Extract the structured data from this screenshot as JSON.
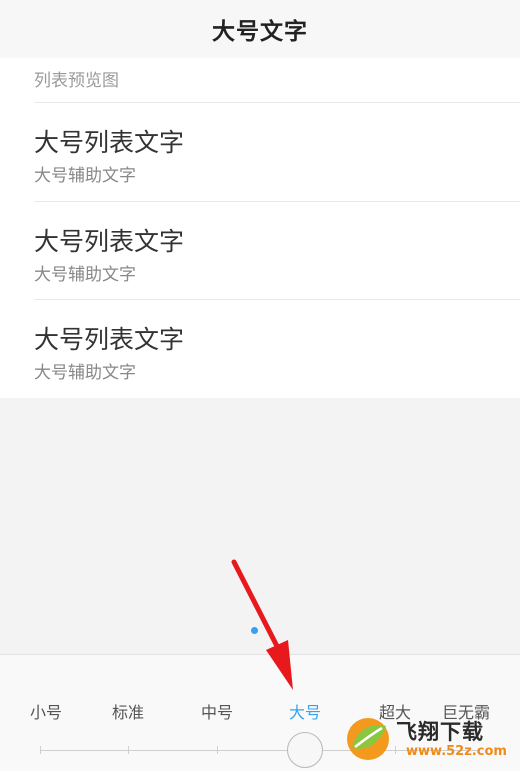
{
  "header": {
    "title": "大号文字"
  },
  "preview": {
    "label": "列表预览图",
    "items": [
      {
        "title": "大号列表文字",
        "subtitle": "大号辅助文字"
      },
      {
        "title": "大号列表文字",
        "subtitle": "大号辅助文字"
      },
      {
        "title": "大号列表文字",
        "subtitle": "大号辅助文字"
      }
    ]
  },
  "font_size_selector": {
    "options": [
      "小号",
      "标准",
      "中号",
      "大号",
      "超大",
      "巨无霸"
    ],
    "selected": "大号",
    "selected_index": 3,
    "accent_color": "#35a3ef"
  },
  "annotation": {
    "arrow_color": "#e8191c"
  },
  "watermark": {
    "name": "飞翔下载",
    "url": "www.52z.com"
  }
}
